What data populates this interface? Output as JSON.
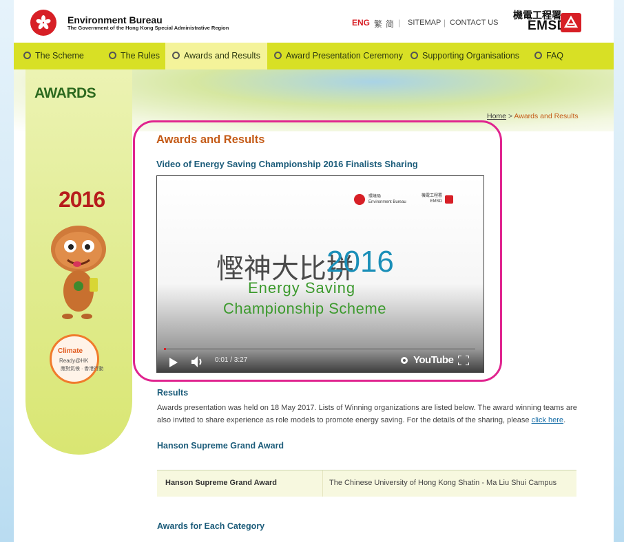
{
  "header": {
    "bureau_name": "Environment Bureau",
    "bureau_sub": "The Government of the Hong Kong Special Administrative Region",
    "lang_eng": "ENG",
    "lang_tc": "繁",
    "lang_sc": "简",
    "sitemap": "SITEMAP",
    "contact": "CONTACT US",
    "emsd_zh": "機電工程署",
    "emsd_en": "EMSD",
    "separator": "|"
  },
  "nav": {
    "items": [
      {
        "label": "The Scheme"
      },
      {
        "label": "The Rules"
      },
      {
        "label": "Awards and Results"
      },
      {
        "label": "Award Presentation Ceremony"
      },
      {
        "label": "Supporting Organisations"
      },
      {
        "label": "FAQ"
      }
    ],
    "active_index": 2
  },
  "sidebar": {
    "title": "AWARDS",
    "year": "2016",
    "climate_line1": "Climate",
    "climate_line2": "Ready@HK",
    "climate_line3": "應對氣候 · 香港行動"
  },
  "breadcrumb": {
    "home": "Home",
    "sep": ">",
    "current": "Awards and Results"
  },
  "main": {
    "page_title": "Awards and Results",
    "video_title": "Video of Energy Saving Championship 2016 Finalists Sharing",
    "video": {
      "logo1_zh": "環境局",
      "logo1_en": "Environment Bureau",
      "logo2_zh": "機電工程署",
      "logo2_en": "EMSD",
      "title_zh": "慳神大比拼",
      "title_year": "2016",
      "title_en_1": "Energy Saving",
      "title_en_2": "Championship Scheme",
      "time": "0:01 / 3:27",
      "youtube": "YouTube",
      "progress": 0.005
    },
    "results_heading": "Results",
    "results_text": "Awards presentation was held on 18 May 2017. Lists of Winning organizations are listed below. The award winning teams are also invited to share experience as role models to promote energy saving. For the details of the sharing, please ",
    "results_link": "click here",
    "results_end": ".",
    "grand_award_heading": "Hanson Supreme Grand Award",
    "grand_award_row": {
      "award": "Hanson Supreme Grand Award",
      "winner": "The Chinese University of Hong Kong Shatin - Ma Liu Shui Campus"
    },
    "category_heading": "Awards for Each Category"
  },
  "colors": {
    "nav_bg": "#d8e025",
    "nav_active": "#f4f39a",
    "title_orange": "#c45a16",
    "heading_blue": "#1c5c7a",
    "highlight": "#e0248f",
    "brand_red": "#d71f26"
  }
}
